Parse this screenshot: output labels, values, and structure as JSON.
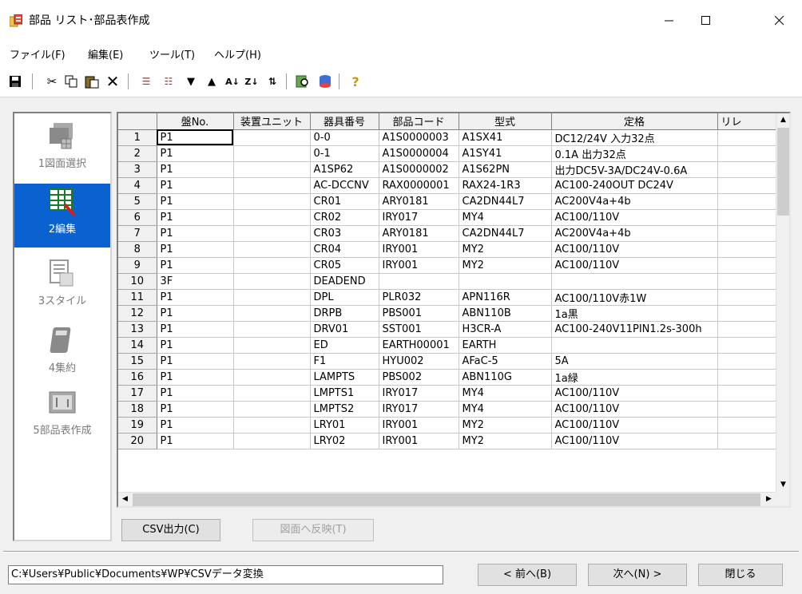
{
  "window": {
    "title": "部品 リスト･部品表作成"
  },
  "menu": [
    {
      "label": "ファイル(F)"
    },
    {
      "label": "編集(E)"
    },
    {
      "label": "ツール(T)"
    },
    {
      "label": "ヘルプ(H)"
    }
  ],
  "steps": [
    {
      "label": "1図面選択",
      "icon": "drawing-select-icon",
      "active": false
    },
    {
      "label": "2編集",
      "icon": "edit-table-icon",
      "active": true
    },
    {
      "label": "3スタイル",
      "icon": "style-icon",
      "active": false
    },
    {
      "label": "4集約",
      "icon": "calculator-icon",
      "active": false
    },
    {
      "label": "5部品表作成",
      "icon": "bom-create-icon",
      "active": false
    }
  ],
  "grid": {
    "columns": [
      "盤No.",
      "装置ユニット",
      "器具番号",
      "部品コード",
      "型式",
      "定格",
      "リレ"
    ],
    "rows": [
      [
        "1",
        "P1",
        "",
        "0-0",
        "A1S0000003",
        "A1SX41",
        "DC12/24V  入力32点",
        ""
      ],
      [
        "2",
        "P1",
        "",
        "0-1",
        "A1S0000004",
        "A1SY41",
        "0.1A  出力32点",
        ""
      ],
      [
        "3",
        "P1",
        "",
        "A1SP62",
        "A1S0000002",
        "A1S62PN",
        "出力DC5V-3A/DC24V-0.6A",
        ""
      ],
      [
        "4",
        "P1",
        "",
        "AC-DCCNV",
        "RAX0000001",
        "RAX24-1R3",
        "AC100-240OUT DC24V",
        ""
      ],
      [
        "5",
        "P1",
        "",
        "CR01",
        "ARY0181",
        "CA2DN44L7",
        "AC200V4a+4b",
        ""
      ],
      [
        "6",
        "P1",
        "",
        "CR02",
        "IRY017",
        "MY4",
        "AC100/110V",
        ""
      ],
      [
        "7",
        "P1",
        "",
        "CR03",
        "ARY0181",
        "CA2DN44L7",
        "AC200V4a+4b",
        ""
      ],
      [
        "8",
        "P1",
        "",
        "CR04",
        "IRY001",
        "MY2",
        "AC100/110V",
        ""
      ],
      [
        "9",
        "P1",
        "",
        "CR05",
        "IRY001",
        "MY2",
        "AC100/110V",
        ""
      ],
      [
        "10",
        "3F",
        "",
        "DEADEND",
        "",
        "",
        "",
        ""
      ],
      [
        "11",
        "P1",
        "",
        "DPL",
        "PLR032",
        "APN116R",
        "AC100/110V赤1W",
        ""
      ],
      [
        "12",
        "P1",
        "",
        "DRPB",
        "PBS001",
        "ABN110B",
        "1a黒",
        ""
      ],
      [
        "13",
        "P1",
        "",
        "DRV01",
        "SST001",
        "H3CR-A",
        "AC100-240V11PIN1.2s-300h",
        ""
      ],
      [
        "14",
        "P1",
        "",
        "ED",
        "EARTH00001",
        "EARTH",
        "",
        ""
      ],
      [
        "15",
        "P1",
        "",
        "F1",
        "HYU002",
        "AFaC-5",
        "5A",
        ""
      ],
      [
        "16",
        "P1",
        "",
        "LAMPTS",
        "PBS002",
        "ABN110G",
        "1a緑",
        ""
      ],
      [
        "17",
        "P1",
        "",
        "LMPTS1",
        "IRY017",
        "MY4",
        "AC100/110V",
        ""
      ],
      [
        "18",
        "P1",
        "",
        "LMPTS2",
        "IRY017",
        "MY4",
        "AC100/110V",
        ""
      ],
      [
        "19",
        "P1",
        "",
        "LRY01",
        "IRY001",
        "MY2",
        "AC100/110V",
        ""
      ],
      [
        "20",
        "P1",
        "",
        "LRY02",
        "IRY001",
        "MY2",
        "AC100/110V",
        ""
      ]
    ]
  },
  "buttons": {
    "csv_export": "CSV出力(C)",
    "reflect_to_drawing": "図面へ反映(T)",
    "prev": "< 前へ(B)",
    "next": "次へ(N) >",
    "close": "閉じる"
  },
  "status": {
    "path": "C:¥Users¥Public¥Documents¥WP¥CSVデータ変換"
  },
  "colors": {
    "accent": "#0a62d0",
    "background": "#f0f0f0"
  }
}
